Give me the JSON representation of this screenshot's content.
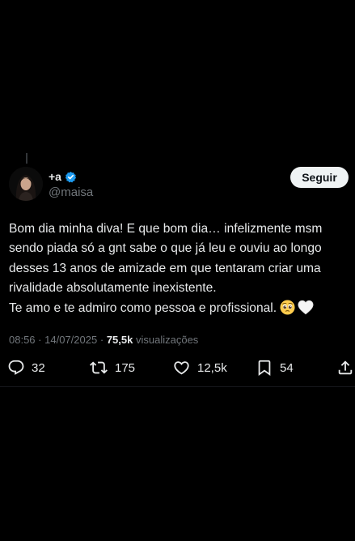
{
  "author": {
    "display_name": "+a",
    "handle": "@maisa",
    "verified": true
  },
  "follow_button": {
    "label": "Seguir"
  },
  "tweet": {
    "line1": "Bom dia minha diva! E que bom dia… infelizmente msm sendo piada só a gnt sabe o que já leu e ouviu ao longo desses 13 anos de amizade em que tentaram criar uma rivalidade absolutamente inexistente.",
    "line2": "Te amo e te admiro como pessoa e profissional.",
    "emojis": [
      "pleading-face",
      "white-heart"
    ]
  },
  "meta": {
    "time": "08:56",
    "separator": "·",
    "date": "14/07/2025",
    "views_count": "75,5k",
    "views_label": "visualizações"
  },
  "actions": {
    "replies": "32",
    "reposts": "175",
    "likes": "12,5k",
    "bookmarks": "54"
  },
  "colors": {
    "background": "#000000",
    "text": "#e7e9ea",
    "secondary_text": "#71767b",
    "verified_badge": "#1d9bf0",
    "follow_button_bg": "#eff3f4"
  }
}
